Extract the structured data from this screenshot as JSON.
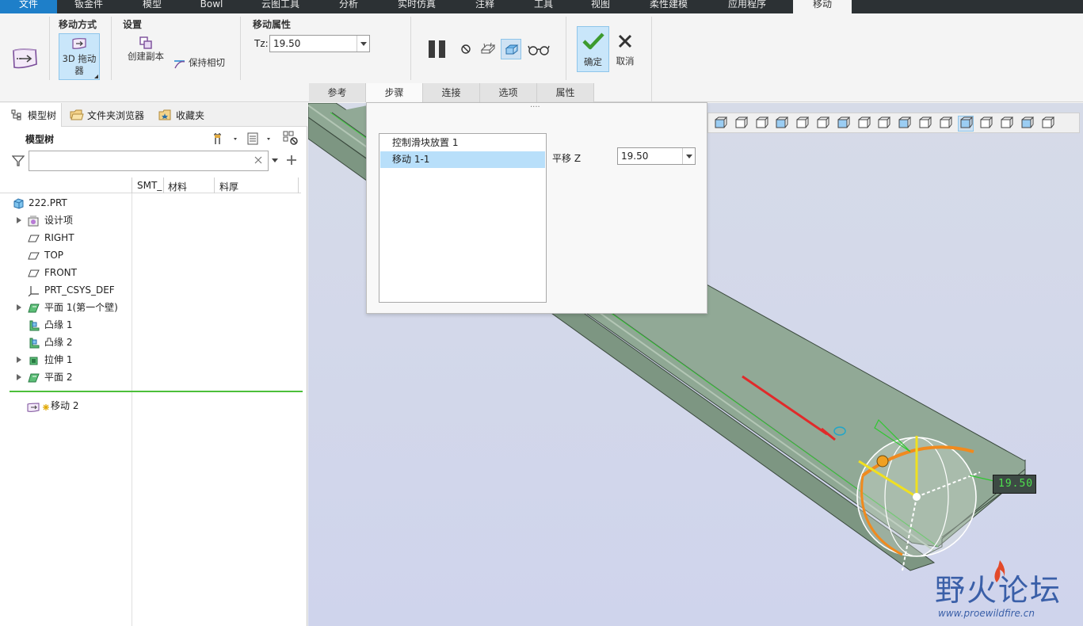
{
  "menu": {
    "tabs": [
      {
        "label": "文件"
      },
      {
        "label": "钣金件"
      },
      {
        "label": "模型"
      },
      {
        "label": "Bowl"
      },
      {
        "label": "云图工具"
      },
      {
        "label": "分析"
      },
      {
        "label": "实时仿真"
      },
      {
        "label": "注释"
      },
      {
        "label": "工具"
      },
      {
        "label": "视图"
      },
      {
        "label": "柔性建模"
      },
      {
        "label": "应用程序"
      },
      {
        "label": "移动"
      }
    ]
  },
  "ribbon": {
    "move_mode": {
      "title": "移动方式",
      "drag_label_line1": "3D 拖动",
      "drag_label_line2": "器"
    },
    "settings": {
      "title": "设置",
      "create_copy": "创建副本",
      "keep_tangent": "保持相切"
    },
    "move_props": {
      "title": "移动属性",
      "tz_label": "Tz:",
      "tz_value": "19.50"
    },
    "ok_label": "确定",
    "cancel_label": "取消",
    "subtabs": [
      "参考",
      "步骤",
      "连接",
      "选项",
      "属性"
    ]
  },
  "nav": {
    "tabs": [
      "模型树",
      "文件夹浏览器",
      "收藏夹"
    ],
    "tree_title": "模型树",
    "filter_placeholder": "",
    "columns": [
      "SMT_",
      "材料",
      "料厚"
    ]
  },
  "tree": {
    "items": [
      {
        "label": "222.PRT",
        "expand": false,
        "icon": "part-icon"
      },
      {
        "label": "设计项",
        "expand": true,
        "icon": "design-items-icon"
      },
      {
        "label": "RIGHT",
        "expand": false,
        "icon": "datum-plane-icon"
      },
      {
        "label": "TOP",
        "expand": false,
        "icon": "datum-plane-icon"
      },
      {
        "label": "FRONT",
        "expand": false,
        "icon": "datum-plane-icon"
      },
      {
        "label": "PRT_CSYS_DEF",
        "expand": false,
        "icon": "csys-icon"
      },
      {
        "label": "平面 1(第一个壁)",
        "expand": true,
        "icon": "planar-wall-icon"
      },
      {
        "label": "凸缘 1",
        "expand": false,
        "icon": "flange-icon"
      },
      {
        "label": "凸缘 2",
        "expand": false,
        "icon": "flange-icon"
      },
      {
        "label": "拉伸 1",
        "expand": true,
        "icon": "extrude-icon"
      },
      {
        "label": "平面 2",
        "expand": true,
        "icon": "planar-wall-icon"
      }
    ],
    "insert_item": {
      "label": "移动 2",
      "icon": "move-feature-icon"
    }
  },
  "step_panel": {
    "items": [
      "控制滑块放置 1",
      "移动 1-1"
    ],
    "translate_label": "平移 Z",
    "translate_value": "19.50"
  },
  "viewport": {
    "dimension_readout": "19.50",
    "watermark_text": "野火论坛",
    "watermark_url": "www.proewildfire.cn"
  },
  "colors": {
    "accent": "#1e7fc9",
    "selection": "#b8dffa",
    "part_green": "#8aa58f",
    "confirm_green": "#3c9a2e"
  }
}
